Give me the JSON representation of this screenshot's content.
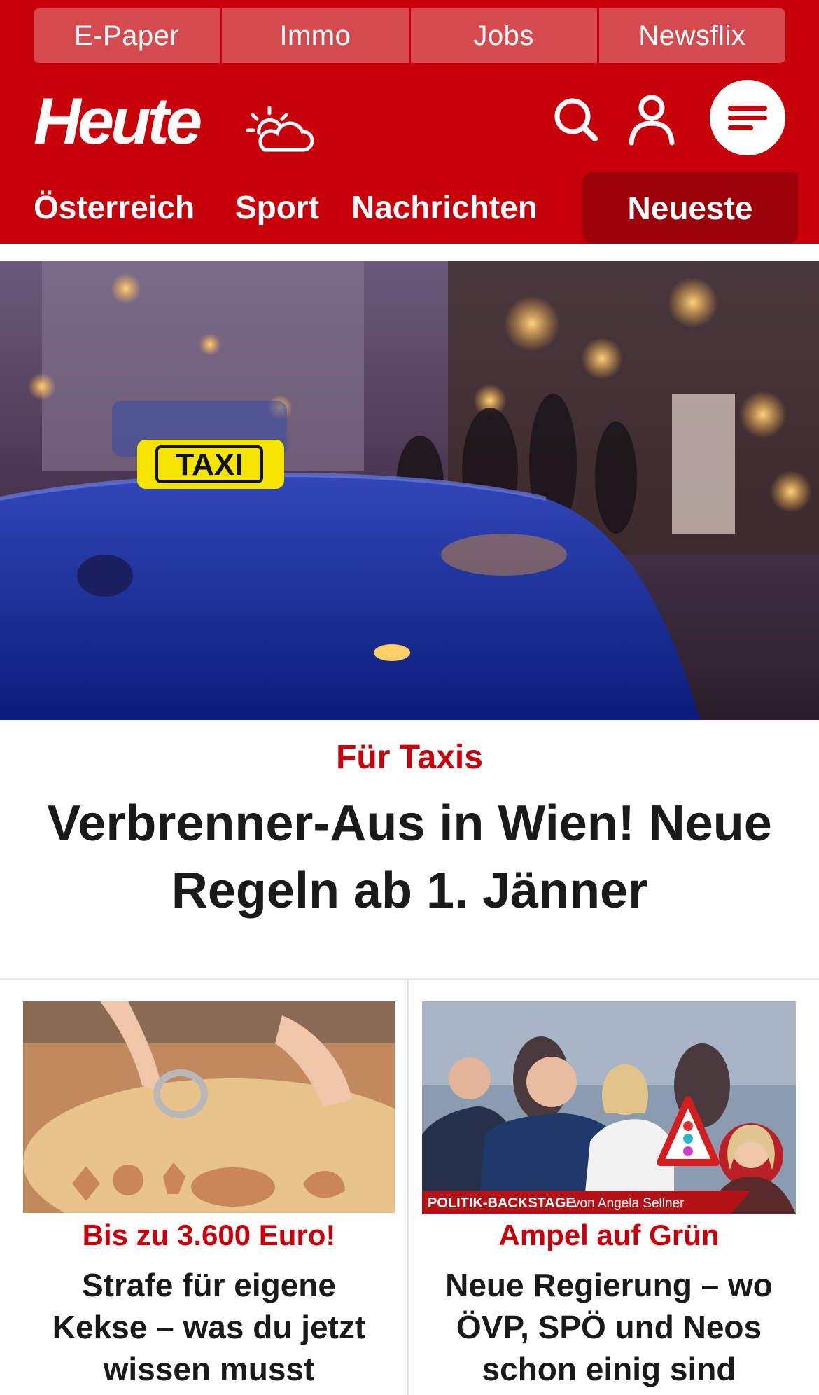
{
  "topbar": {
    "links": [
      "E-Paper",
      "Immo",
      "Jobs",
      "Newsflix"
    ]
  },
  "brand": {
    "logo_text": "Heute"
  },
  "icons": {
    "weather": "partly-cloudy-icon",
    "search": "search-icon",
    "account": "user-icon",
    "menu": "hamburger-menu-icon"
  },
  "nav": {
    "items": [
      "Österreich",
      "Sport",
      "Nachrichten"
    ],
    "active_label": "Neueste"
  },
  "hero": {
    "image_sign_text": "TAXI",
    "kicker": "Für Taxis",
    "title": "Verbrenner-Aus in Wien! Neue Regeln ab 1. Jänner"
  },
  "cards": [
    {
      "kicker": "Bis zu 3.600 Euro!",
      "title": "Strafe für eigene Kekse – was du jetzt wissen musst"
    },
    {
      "image_banner_bold": "POLITIK-BACKSTAGE",
      "image_banner_rest": "von Angela Sellner",
      "kicker": "Ampel auf Grün",
      "title": "Neue Regierung – wo ÖVP, SPÖ und Neos schon einig sind"
    }
  ],
  "colors": {
    "brand_red": "#c8000a",
    "nav_active": "#9c0008",
    "topbar_tab": "#d54a4f",
    "text_dark": "#1a1a1a"
  }
}
